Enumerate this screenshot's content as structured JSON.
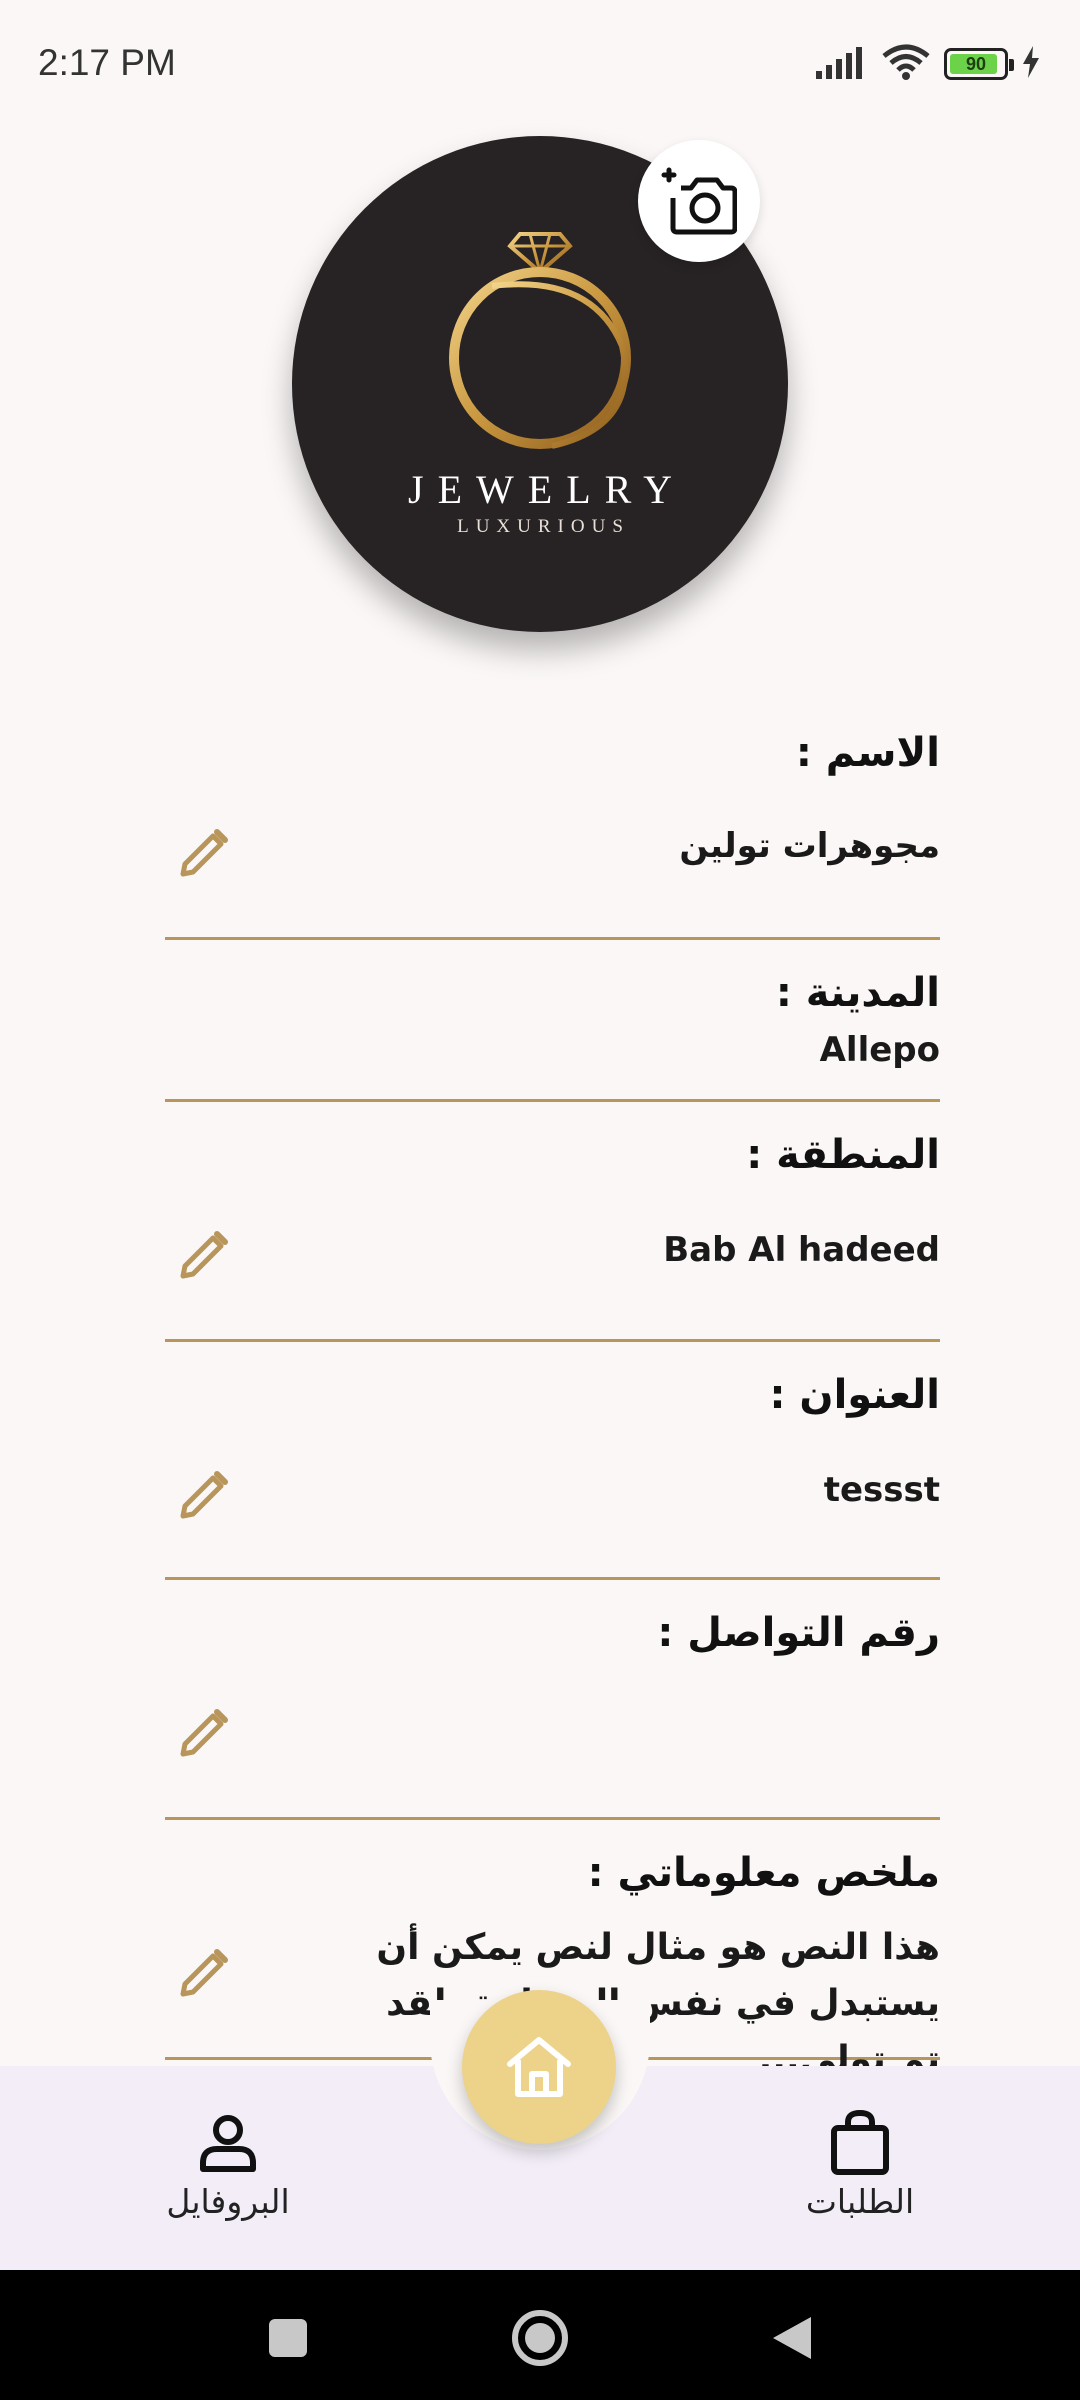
{
  "status_bar": {
    "time": "2:17 PM",
    "battery": "90",
    "icons": [
      "signal-icon",
      "wifi-icon",
      "battery-icon",
      "charging-icon"
    ]
  },
  "profile": {
    "logo_title": "JEWELRY",
    "logo_subtitle": "LUXURIOUS",
    "camera_icon": "add-photo-icon"
  },
  "fields": [
    {
      "label": "الاسم :",
      "value": "مجوهرات تولين",
      "editable": true
    },
    {
      "label": "المدينة :",
      "value": "Allepo",
      "editable": false
    },
    {
      "label": "المنطقة :",
      "value": "Bab Al hadeed",
      "editable": true
    },
    {
      "label": "العنوان :",
      "value": "tessst",
      "editable": true
    },
    {
      "label": "رقم التواصل :",
      "value": "",
      "editable": true
    },
    {
      "label": "ملخص معلوماتي :",
      "value": "هذا النص هو مثال لنص يمكن أن يستبدل في نفس المساحة، لقد تم تولي...",
      "editable": true
    }
  ],
  "bottom_nav": {
    "profile_label": "البروفايل",
    "orders_label": "الطلبات",
    "home_icon": "home-icon"
  },
  "colors": {
    "accent_gold": "#b8955a",
    "fab": "#edd289",
    "nav_bg": "#f2edf7",
    "background": "#faf7f6"
  }
}
